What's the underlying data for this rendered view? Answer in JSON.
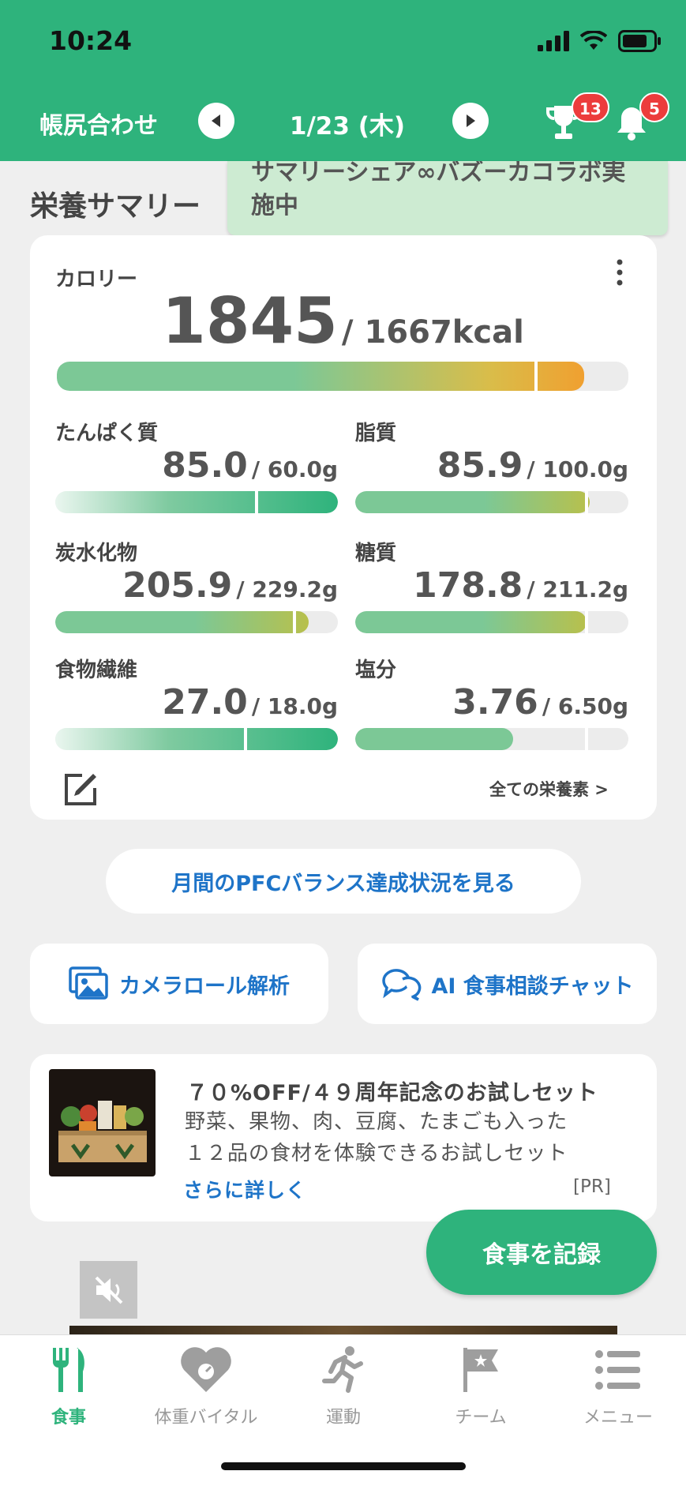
{
  "status": {
    "time": "10:24"
  },
  "header": {
    "title": "帳尻合わせ",
    "date": "1/23 (木)",
    "trophy_badge": "13",
    "bell_badge": "5"
  },
  "summary": {
    "section_title": "栄養サマリー",
    "tooltip": "サマリーシェア∞バズーカコラボ実施中",
    "calorie": {
      "label": "カロリー",
      "value": "1845",
      "target": "/ 1667kcal",
      "progress": 1.107
    },
    "nutrients": [
      {
        "label": "たんぱく質",
        "value": "85.0",
        "target": "/ 60.0g",
        "progress": 1.417
      },
      {
        "label": "脂質",
        "value": "85.9",
        "target": "/ 100.0g",
        "progress": 0.859
      },
      {
        "label": "炭水化物",
        "value": "205.9",
        "target": "/ 229.2g",
        "progress": 0.898
      },
      {
        "label": "糖質",
        "value": "178.8",
        "target": "/ 211.2g",
        "progress": 0.847
      },
      {
        "label": "食物繊維",
        "value": "27.0",
        "target": "/ 18.0g",
        "progress": 1.5
      },
      {
        "label": "塩分",
        "value": "3.76",
        "target": "/ 6.50g",
        "progress": 0.578
      }
    ],
    "all_nutrients_link": "全ての栄養素 >"
  },
  "buttons": {
    "pfc_balance": "月間のPFCバランス達成状況を見る",
    "camera_roll": "カメラロール解析",
    "ai_chat": "AI 食事相談チャット",
    "record_meal": "食事を記録"
  },
  "ad": {
    "title": "７０%OFF/４９周年記念のお試しセット",
    "desc_line1": "野菜、果物、肉、豆腐、たまごも入った",
    "desc_line2": "１２品の食材を体験できるお試しセット",
    "more": "さらに詳しく",
    "pr": "[PR]"
  },
  "tabs": [
    {
      "label": "食事",
      "icon": "fork-knife-icon",
      "active": true
    },
    {
      "label": "体重バイタル",
      "icon": "heart-scale-icon",
      "active": false
    },
    {
      "label": "運動",
      "icon": "runner-icon",
      "active": false
    },
    {
      "label": "チーム",
      "icon": "flag-star-icon",
      "active": false
    },
    {
      "label": "メニュー",
      "icon": "menu-list-icon",
      "active": false
    }
  ],
  "colors": {
    "brand": "#2eb37c",
    "link": "#1e74c8",
    "badge": "#ec3c3c",
    "tooltip": "#cdebd2"
  }
}
